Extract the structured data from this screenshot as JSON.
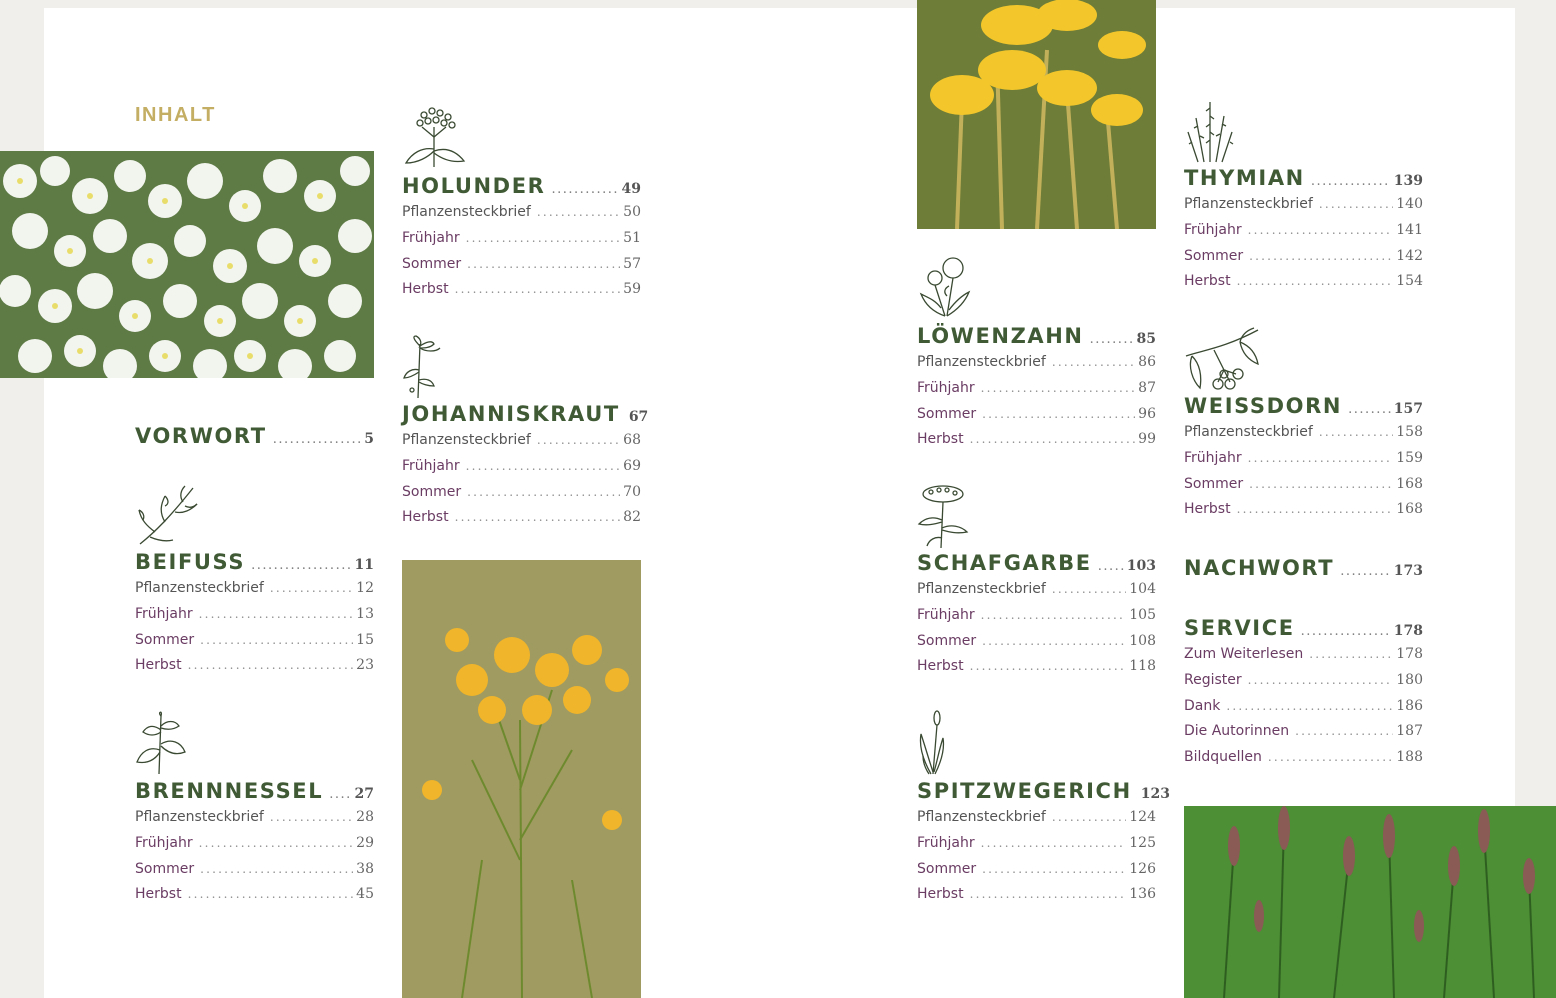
{
  "toc_label": "INHALT",
  "vorwort": {
    "title": "VORWORT",
    "page": "5"
  },
  "beifuss": {
    "title": "BEIFUSS",
    "page": "11",
    "entries": [
      {
        "label": "Pflanzensteckbrief",
        "page": "12"
      },
      {
        "label": "Frühjahr",
        "page": "13"
      },
      {
        "label": "Sommer",
        "page": "15"
      },
      {
        "label": "Herbst",
        "page": "23"
      }
    ]
  },
  "brennnessel": {
    "title": "BRENNNESSEL",
    "page": "27",
    "entries": [
      {
        "label": "Pflanzensteckbrief",
        "page": "28"
      },
      {
        "label": "Frühjahr",
        "page": "29"
      },
      {
        "label": "Sommer",
        "page": "38"
      },
      {
        "label": "Herbst",
        "page": "45"
      }
    ]
  },
  "holunder": {
    "title": "HOLUNDER",
    "page": "49",
    "entries": [
      {
        "label": "Pflanzensteckbrief",
        "page": "50"
      },
      {
        "label": "Frühjahr",
        "page": "51"
      },
      {
        "label": "Sommer",
        "page": "57"
      },
      {
        "label": "Herbst",
        "page": "59"
      }
    ]
  },
  "johanniskraut": {
    "title": "JOHANNISKRAUT",
    "page": "67",
    "entries": [
      {
        "label": "Pflanzensteckbrief",
        "page": "68"
      },
      {
        "label": "Frühjahr",
        "page": "69"
      },
      {
        "label": "Sommer",
        "page": "70"
      },
      {
        "label": "Herbst",
        "page": "82"
      }
    ]
  },
  "loewenzahn": {
    "title": "LÖWENZAHN",
    "page": "85",
    "entries": [
      {
        "label": "Pflanzensteckbrief",
        "page": "86"
      },
      {
        "label": "Frühjahr",
        "page": "87"
      },
      {
        "label": "Sommer",
        "page": "96"
      },
      {
        "label": "Herbst",
        "page": "99"
      }
    ]
  },
  "schafgarbe": {
    "title": "SCHAFGARBE",
    "page": "103",
    "entries": [
      {
        "label": "Pflanzensteckbrief",
        "page": "104"
      },
      {
        "label": "Frühjahr",
        "page": "105"
      },
      {
        "label": "Sommer",
        "page": "108"
      },
      {
        "label": "Herbst",
        "page": "118"
      }
    ]
  },
  "spitzwegerich": {
    "title": "SPITZWEGERICH",
    "page": "123",
    "entries": [
      {
        "label": "Pflanzensteckbrief",
        "page": "124"
      },
      {
        "label": "Frühjahr",
        "page": "125"
      },
      {
        "label": "Sommer",
        "page": "126"
      },
      {
        "label": "Herbst",
        "page": "136"
      }
    ]
  },
  "thymian": {
    "title": "THYMIAN",
    "page": "139",
    "entries": [
      {
        "label": "Pflanzensteckbrief",
        "page": "140"
      },
      {
        "label": "Frühjahr",
        "page": "141"
      },
      {
        "label": "Sommer",
        "page": "142"
      },
      {
        "label": "Herbst",
        "page": "154"
      }
    ]
  },
  "weissdorn": {
    "title": "WEISSDORN",
    "page": "157",
    "entries": [
      {
        "label": "Pflanzensteckbrief",
        "page": "158"
      },
      {
        "label": "Frühjahr",
        "page": "159"
      },
      {
        "label": "Sommer",
        "page": "168"
      },
      {
        "label": "Herbst",
        "page": "168"
      }
    ]
  },
  "nachwort": {
    "title": "NACHWORT",
    "page": "173"
  },
  "service": {
    "title": "SERVICE",
    "page": "178",
    "entries": [
      {
        "label": "Zum Weiterlesen",
        "page": "178"
      },
      {
        "label": "Register",
        "page": "180"
      },
      {
        "label": "Dank",
        "page": "186"
      },
      {
        "label": "Die Autorinnen",
        "page": "187"
      },
      {
        "label": "Bildquellen",
        "page": "188"
      }
    ]
  },
  "colors": {
    "heading": "#3f5a35",
    "accent": "#c3ae64",
    "season": "#6a3c63",
    "text": "#555555"
  },
  "icons": [
    "elderflower-icon",
    "wormwood-icon",
    "nettle-icon",
    "st-johns-wort-icon",
    "dandelion-icon",
    "yarrow-icon",
    "plantain-icon",
    "thyme-icon",
    "hawthorn-icon"
  ]
}
